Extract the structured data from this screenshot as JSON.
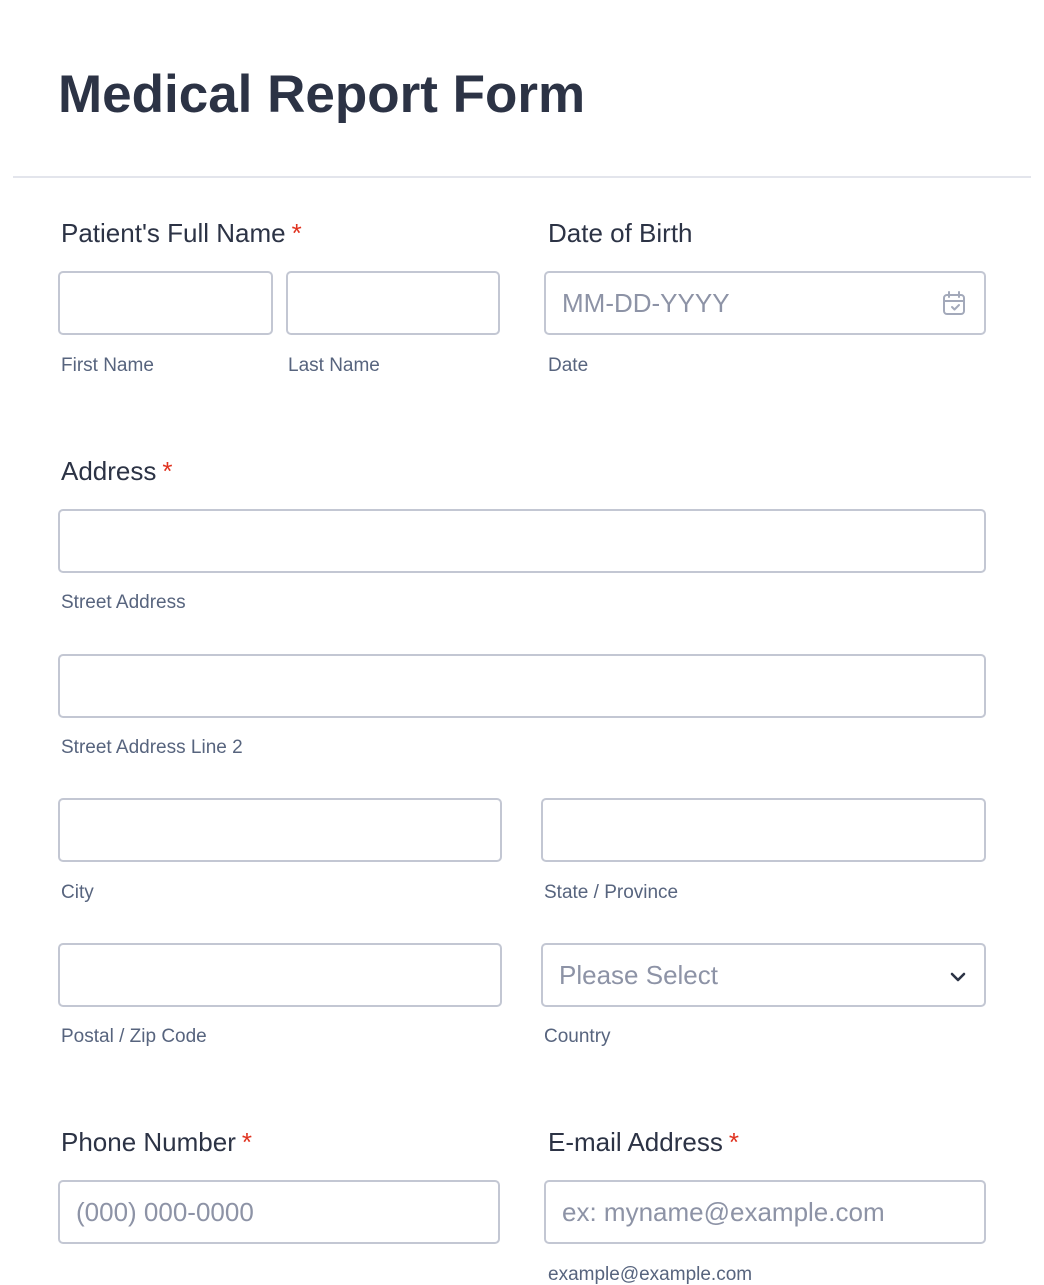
{
  "form": {
    "title": "Medical Report Form"
  },
  "patient_name": {
    "label": "Patient's Full Name",
    "required_mark": "*",
    "first": {
      "value": "",
      "sublabel": "First Name"
    },
    "last": {
      "value": "",
      "sublabel": "Last Name"
    }
  },
  "dob": {
    "label": "Date of Birth",
    "placeholder": "MM-DD-YYYY",
    "sublabel": "Date",
    "icon": "calendar-icon"
  },
  "address": {
    "label": "Address",
    "required_mark": "*",
    "street": {
      "value": "",
      "sublabel": "Street Address"
    },
    "street2": {
      "value": "",
      "sublabel": "Street Address Line 2"
    },
    "city": {
      "value": "",
      "sublabel": "City"
    },
    "state": {
      "value": "",
      "sublabel": "State / Province"
    },
    "postal": {
      "value": "",
      "sublabel": "Postal / Zip Code"
    },
    "country": {
      "selected": "Please Select",
      "sublabel": "Country",
      "icon": "chevron-down-icon"
    }
  },
  "phone": {
    "label": "Phone Number",
    "required_mark": "*",
    "placeholder": "(000) 000-0000"
  },
  "email": {
    "label": "E-mail Address",
    "required_mark": "*",
    "placeholder": "ex: myname@example.com",
    "sublabel": "example@example.com"
  },
  "colors": {
    "text": "#2c3345",
    "required": "#e0321f",
    "border": "#c3c7d3",
    "placeholder": "#8d93a6",
    "sublabel": "#57647e"
  }
}
